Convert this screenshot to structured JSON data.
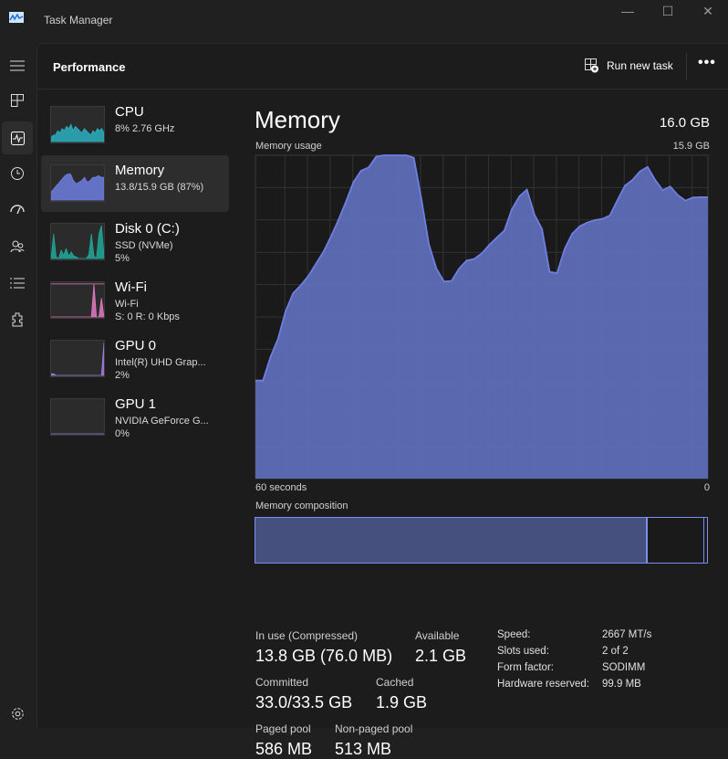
{
  "window": {
    "title": "Task Manager"
  },
  "header": {
    "title": "Performance",
    "run_new_task": "Run new task",
    "more": "•••"
  },
  "nav": {
    "icons": [
      "hamburger-icon",
      "processes-icon",
      "performance-icon",
      "app-history-icon",
      "startup-apps-icon",
      "users-icon",
      "details-icon",
      "services-icon",
      "settings-icon"
    ]
  },
  "devices": [
    {
      "name": "CPU",
      "sub1": "8%  2.76 GHz",
      "sub2": "",
      "color": "#2ab0c0",
      "history": [
        2,
        3,
        3,
        5,
        4,
        6,
        5,
        7,
        6,
        8,
        5,
        7,
        6,
        5,
        4,
        6,
        5,
        4,
        3,
        5,
        4,
        6,
        5,
        6,
        4
      ]
    },
    {
      "name": "Memory",
      "sub1": "13.8/15.9 GB (87%)",
      "sub2": "",
      "color": "#6f7fe0",
      "history": [
        5,
        7,
        9,
        11,
        13,
        15,
        16,
        16,
        12,
        10,
        11,
        12,
        14,
        11,
        12,
        14,
        14,
        15,
        14,
        14
      ]
    },
    {
      "name": "Disk 0 (C:)",
      "sub1": "SSD (NVMe)",
      "sub2": "5%",
      "color": "#1fa89a",
      "history": [
        0,
        30,
        2,
        0,
        10,
        4,
        12,
        3,
        8,
        3,
        2,
        0,
        0,
        0,
        0,
        5,
        30,
        3,
        0,
        30,
        40,
        5
      ]
    },
    {
      "name": "Wi-Fi",
      "sub1": "Wi-Fi",
      "sub2": "S: 0 R: 0 Kbps",
      "color": "#e07ac0",
      "history": [
        0,
        0,
        0,
        0,
        0,
        0,
        0,
        0,
        0,
        0,
        0,
        0,
        0,
        0,
        0,
        0,
        0,
        35,
        0,
        0,
        20,
        0
      ]
    },
    {
      "name": "GPU 0",
      "sub1": "Intel(R) UHD Grap...",
      "sub2": "2%",
      "color": "#a47ee0",
      "history": [
        1,
        1,
        0,
        0,
        0,
        0,
        0,
        0,
        0,
        0,
        0,
        0,
        0,
        0,
        0,
        0,
        0,
        0,
        0,
        0,
        0,
        20
      ]
    },
    {
      "name": "GPU 1",
      "sub1": "NVIDIA GeForce G...",
      "sub2": "0%",
      "color": "#a47ee0",
      "history": [
        0,
        0,
        0,
        0,
        0,
        0,
        0,
        0,
        0,
        0
      ]
    }
  ],
  "main": {
    "title": "Memory",
    "total": "16.0 GB",
    "usage_label": "Memory usage",
    "usage_max": "15.9 GB",
    "x_left": "60 seconds",
    "x_right": "0",
    "composition_label": "Memory composition",
    "composition": {
      "in_use_gb": 13.8,
      "standby_gb": 1.9,
      "total_gb": 15.9
    },
    "stats": {
      "in_use_label": "In use (Compressed)",
      "in_use": "13.8 GB (76.0 MB)",
      "available_label": "Available",
      "available": "2.1 GB",
      "committed_label": "Committed",
      "committed": "33.0/33.5 GB",
      "cached_label": "Cached",
      "cached": "1.9 GB",
      "paged_label": "Paged pool",
      "paged": "586 MB",
      "nonpaged_label": "Non-paged pool",
      "nonpaged": "513 MB"
    },
    "specs": [
      {
        "k": "Speed:",
        "v": "2667 MT/s"
      },
      {
        "k": "Slots used:",
        "v": "2 of 2"
      },
      {
        "k": "Form factor:",
        "v": "SODIMM"
      },
      {
        "k": "Hardware reserved:",
        "v": "99.9 MB"
      }
    ]
  },
  "chart_data": {
    "type": "area",
    "xlabel": "",
    "ylabel": "",
    "x_range_seconds": [
      60,
      0
    ],
    "ylim": [
      0,
      15.9
    ],
    "grid": true,
    "color": "#6f7fe0",
    "values": [
      4.82,
      4.82,
      5.98,
      6.88,
      8.23,
      9.12,
      9.5,
      9.95,
      10.55,
      11.14,
      11.89,
      12.71,
      13.61,
      14.58,
      15.14,
      15.3,
      15.83,
      15.9,
      15.9,
      15.9,
      15.9,
      15.78,
      13.76,
      11.52,
      10.32,
      9.69,
      9.72,
      10.32,
      10.72,
      10.8,
      11.07,
      11.49,
      11.85,
      12.19,
      13.24,
      13.88,
      14.21,
      12.98,
      12.27,
      10.17,
      10.1,
      11.29,
      12.04,
      12.41,
      12.59,
      12.71,
      12.77,
      12.94,
      13.69,
      14.4,
      14.69,
      15.11,
      15.33,
      14.69,
      14.18,
      14.36,
      13.94,
      13.67,
      13.82,
      13.84,
      13.84
    ]
  }
}
